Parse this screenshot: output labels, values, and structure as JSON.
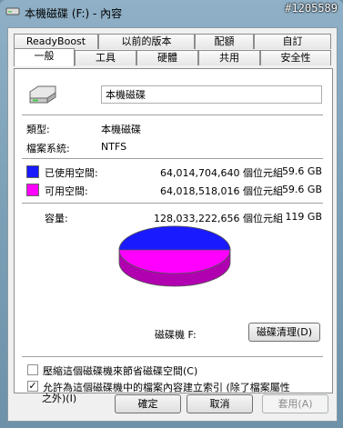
{
  "window": {
    "title": "本機磁碟 (F:) - 內容",
    "watermark": "#1205589"
  },
  "tabs_back": [
    "ReadyBoost",
    "以前的版本",
    "配額",
    "自訂"
  ],
  "tabs_front": [
    "一般",
    "工具",
    "硬體",
    "共用",
    "安全性"
  ],
  "active_tab": "一般",
  "general": {
    "drive_name": "本機磁碟",
    "type_label": "類型:",
    "type_value": "本機磁碟",
    "fs_label": "檔案系統:",
    "fs_value": "NTFS",
    "used_label": "已使用空間:",
    "used_bytes": "64,014,704,640 個位元組",
    "used_size": "59.6 GB",
    "free_label": "可用空間:",
    "free_bytes": "64,018,518,016 個位元組",
    "free_size": "59.6 GB",
    "capacity_label": "容量:",
    "capacity_bytes": "128,033,222,656 個位元組",
    "capacity_size": "119 GB",
    "disk_label": "磁碟機 F:",
    "cleanup_button": "磁碟清理(D)",
    "compress_label": "壓縮這個磁碟機來節省磁碟空間(C)",
    "compress_checked": false,
    "index_label_line1": "允許為這個磁碟機中的檔案內容建立索引 (除了檔案屬性",
    "index_label_line2": "之外)(I)",
    "index_checked": true
  },
  "colors": {
    "used": "#1a1aff",
    "free": "#ff00ff"
  },
  "buttons": {
    "ok": "確定",
    "cancel": "取消",
    "apply": "套用(A)"
  }
}
